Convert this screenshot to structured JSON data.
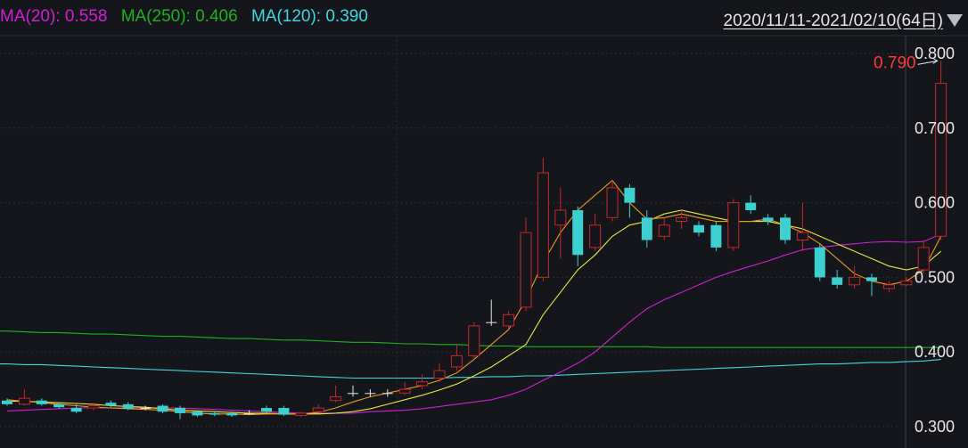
{
  "legend": {
    "ma20": {
      "label": "MA(20):",
      "value": "0.558",
      "color": "#d020d0"
    },
    "ma250": {
      "label": "MA(250):",
      "value": "0.406",
      "color": "#20b020"
    },
    "ma120": {
      "label": "MA(120):",
      "value": "0.390",
      "color": "#40d8e0"
    }
  },
  "range": {
    "text": "2020/11/11-2021/02/10(64日)"
  },
  "colors": {
    "background": "#14161b",
    "up": "#c82828",
    "down": "#3ed0d0",
    "ma5": "#e89a20",
    "ma10": "#e8e840",
    "ma20": "#d020d0",
    "ma120": "#40d8e0",
    "ma250": "#20b020",
    "high_label": "#ff3a3a",
    "grid": "#2a2d35"
  },
  "chart_data": {
    "type": "candlestick",
    "ylim": [
      0.29,
      0.815
    ],
    "yticks": [
      "0.800",
      "0.700",
      "0.600",
      "0.500",
      "0.400",
      "0.300"
    ],
    "high_marker": "0.790",
    "candles": [
      [
        0.335,
        0.33,
        0.338,
        0.328
      ],
      [
        0.33,
        0.338,
        0.35,
        0.328
      ],
      [
        0.335,
        0.33,
        0.338,
        0.328
      ],
      [
        0.33,
        0.326,
        0.333,
        0.324
      ],
      [
        0.325,
        0.32,
        0.33,
        0.318
      ],
      [
        0.325,
        0.328,
        0.332,
        0.322
      ],
      [
        0.332,
        0.328,
        0.335,
        0.326
      ],
      [
        0.33,
        0.324,
        0.333,
        0.322
      ],
      [
        0.325,
        0.325,
        0.328,
        0.322
      ],
      [
        0.328,
        0.32,
        0.33,
        0.318
      ],
      [
        0.325,
        0.318,
        0.328,
        0.31
      ],
      [
        0.32,
        0.315,
        0.322,
        0.313
      ],
      [
        0.318,
        0.316,
        0.32,
        0.314
      ],
      [
        0.318,
        0.315,
        0.32,
        0.313
      ],
      [
        0.318,
        0.318,
        0.322,
        0.316
      ],
      [
        0.325,
        0.32,
        0.328,
        0.318
      ],
      [
        0.325,
        0.316,
        0.328,
        0.314
      ],
      [
        0.315,
        0.318,
        0.32,
        0.313
      ],
      [
        0.32,
        0.325,
        0.33,
        0.318
      ],
      [
        0.335,
        0.34,
        0.355,
        0.333
      ],
      [
        0.345,
        0.345,
        0.355,
        0.34
      ],
      [
        0.345,
        0.345,
        0.35,
        0.34
      ],
      [
        0.345,
        0.345,
        0.35,
        0.34
      ],
      [
        0.345,
        0.35,
        0.36,
        0.342
      ],
      [
        0.355,
        0.36,
        0.37,
        0.35
      ],
      [
        0.365,
        0.375,
        0.385,
        0.36
      ],
      [
        0.38,
        0.395,
        0.41,
        0.375
      ],
      [
        0.395,
        0.435,
        0.44,
        0.39
      ],
      [
        0.44,
        0.44,
        0.47,
        0.435
      ],
      [
        0.435,
        0.45,
        0.455,
        0.43
      ],
      [
        0.46,
        0.56,
        0.58,
        0.455
      ],
      [
        0.5,
        0.64,
        0.66,
        0.495
      ],
      [
        0.57,
        0.59,
        0.62,
        0.525
      ],
      [
        0.59,
        0.53,
        0.595,
        0.515
      ],
      [
        0.54,
        0.57,
        0.585,
        0.535
      ],
      [
        0.58,
        0.62,
        0.63,
        0.575
      ],
      [
        0.62,
        0.6,
        0.625,
        0.58
      ],
      [
        0.58,
        0.55,
        0.59,
        0.54
      ],
      [
        0.555,
        0.57,
        0.58,
        0.55
      ],
      [
        0.575,
        0.58,
        0.59,
        0.565
      ],
      [
        0.57,
        0.56,
        0.575,
        0.555
      ],
      [
        0.57,
        0.54,
        0.575,
        0.535
      ],
      [
        0.54,
        0.6,
        0.605,
        0.535
      ],
      [
        0.6,
        0.59,
        0.61,
        0.585
      ],
      [
        0.58,
        0.575,
        0.585,
        0.57
      ],
      [
        0.58,
        0.55,
        0.585,
        0.545
      ],
      [
        0.55,
        0.56,
        0.6,
        0.535
      ],
      [
        0.54,
        0.5,
        0.545,
        0.495
      ],
      [
        0.5,
        0.49,
        0.51,
        0.485
      ],
      [
        0.49,
        0.5,
        0.515,
        0.485
      ],
      [
        0.5,
        0.495,
        0.505,
        0.475
      ],
      [
        0.485,
        0.49,
        0.495,
        0.48
      ],
      [
        0.49,
        0.495,
        0.5,
        0.488
      ],
      [
        0.51,
        0.54,
        0.55,
        0.505
      ],
      [
        0.555,
        0.76,
        0.79,
        0.55
      ]
    ],
    "ma5": [
      0.336,
      0.334,
      0.332,
      0.33,
      0.328,
      0.326,
      0.325,
      0.324,
      0.323,
      0.322,
      0.32,
      0.318,
      0.317,
      0.317,
      0.316,
      0.317,
      0.317,
      0.317,
      0.319,
      0.325,
      0.333,
      0.34,
      0.345,
      0.35,
      0.355,
      0.362,
      0.372,
      0.39,
      0.41,
      0.43,
      0.47,
      0.52,
      0.56,
      0.59,
      0.61,
      0.63,
      0.6,
      0.578,
      0.58,
      0.585,
      0.58,
      0.575,
      0.575,
      0.575,
      0.578,
      0.57,
      0.56,
      0.545,
      0.525,
      0.505,
      0.495,
      0.49,
      0.495,
      0.51,
      0.555
    ],
    "ma10": [
      0.334,
      0.334,
      0.333,
      0.332,
      0.331,
      0.33,
      0.328,
      0.327,
      0.326,
      0.324,
      0.322,
      0.321,
      0.32,
      0.319,
      0.318,
      0.318,
      0.317,
      0.317,
      0.317,
      0.318,
      0.32,
      0.324,
      0.33,
      0.336,
      0.342,
      0.349,
      0.357,
      0.368,
      0.38,
      0.395,
      0.41,
      0.45,
      0.48,
      0.51,
      0.53,
      0.555,
      0.57,
      0.575,
      0.585,
      0.59,
      0.585,
      0.58,
      0.575,
      0.575,
      0.575,
      0.57,
      0.565,
      0.555,
      0.545,
      0.535,
      0.525,
      0.515,
      0.51,
      0.515,
      0.535
    ],
    "ma20": [
      0.321,
      0.322,
      0.323,
      0.324,
      0.325,
      0.325,
      0.325,
      0.325,
      0.325,
      0.325,
      0.325,
      0.324,
      0.323,
      0.322,
      0.321,
      0.32,
      0.319,
      0.318,
      0.318,
      0.318,
      0.318,
      0.32,
      0.321,
      0.322,
      0.324,
      0.327,
      0.33,
      0.333,
      0.336,
      0.342,
      0.35,
      0.362,
      0.373,
      0.385,
      0.4,
      0.42,
      0.44,
      0.458,
      0.47,
      0.48,
      0.49,
      0.5,
      0.508,
      0.515,
      0.522,
      0.53,
      0.537,
      0.54,
      0.543,
      0.545,
      0.547,
      0.548,
      0.547,
      0.548,
      0.558
    ],
    "ma120": [
      0.384,
      0.383,
      0.383,
      0.382,
      0.381,
      0.38,
      0.379,
      0.378,
      0.377,
      0.376,
      0.375,
      0.374,
      0.373,
      0.372,
      0.371,
      0.37,
      0.369,
      0.368,
      0.367,
      0.366,
      0.365,
      0.365,
      0.365,
      0.365,
      0.365,
      0.365,
      0.366,
      0.366,
      0.367,
      0.367,
      0.368,
      0.368,
      0.369,
      0.37,
      0.371,
      0.372,
      0.373,
      0.374,
      0.375,
      0.376,
      0.377,
      0.378,
      0.379,
      0.38,
      0.381,
      0.382,
      0.383,
      0.384,
      0.384,
      0.385,
      0.386,
      0.386,
      0.387,
      0.388,
      0.39
    ],
    "ma250": [
      0.428,
      0.427,
      0.426,
      0.426,
      0.425,
      0.424,
      0.424,
      0.423,
      0.422,
      0.421,
      0.421,
      0.42,
      0.419,
      0.418,
      0.418,
      0.417,
      0.416,
      0.416,
      0.415,
      0.414,
      0.413,
      0.413,
      0.412,
      0.411,
      0.411,
      0.41,
      0.41,
      0.409,
      0.408,
      0.408,
      0.407,
      0.407,
      0.407,
      0.407,
      0.407,
      0.407,
      0.407,
      0.407,
      0.406,
      0.406,
      0.406,
      0.406,
      0.406,
      0.406,
      0.406,
      0.406,
      0.406,
      0.406,
      0.406,
      0.406,
      0.406,
      0.406,
      0.406,
      0.406,
      0.406
    ]
  }
}
